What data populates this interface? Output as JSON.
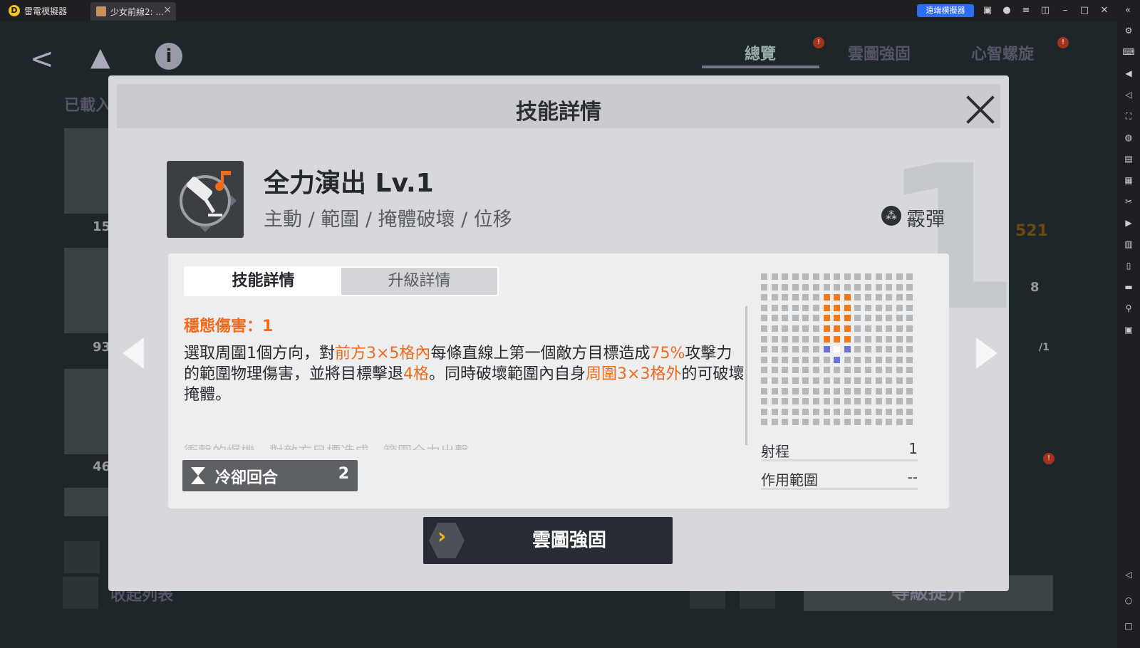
{
  "window": {
    "app_name": "雷電模擬器",
    "tab_label": "少女前線2: ...",
    "tab_close": "×",
    "sync_button": "遠端模擬器",
    "icons": [
      "gift-icon",
      "account-icon",
      "menu-icon",
      "restore-icon",
      "minimize-icon",
      "maximize-icon",
      "close-icon",
      "collapse-icon"
    ]
  },
  "sidebar": {
    "icons": [
      "settings-icon",
      "keyboard-icon",
      "volume-up-icon",
      "volume-down-icon",
      "screenshot-icon",
      "lock-icon",
      "apk-icon",
      "robot-icon",
      "scissors-icon",
      "record-icon",
      "operation-icon",
      "multi-instance-icon",
      "folder-icon",
      "location-icon",
      "shake-icon",
      "back-icon",
      "home-icon",
      "recent-icon"
    ]
  },
  "background": {
    "top_tabs": [
      "總覽",
      "雲圖強固",
      "心智螺旋"
    ],
    "loaded_label": "已載入",
    "card_numbers": [
      "15",
      "93",
      "46"
    ],
    "right_number": "521",
    "shield_value": "8",
    "fraction": "/1",
    "collapse_label": "收起列表",
    "level_up_button": "等級提升"
  },
  "modal": {
    "title": "技能詳情",
    "big_number": "1",
    "skill_name": "全力演出 Lv.1",
    "skill_tags": "主動 / 範圍 / 掩體破壞 / 位移",
    "ammo_type": "霰彈",
    "tabs": {
      "active": "技能詳情",
      "inactive": "升級詳情"
    },
    "stable_damage": "穩態傷害：1",
    "description": {
      "p1": "選取周圍1個方向，對",
      "h1": "前方3×5格內",
      "p2": "每條直線上第一個敵方目標造成",
      "h2": "75%",
      "p3": "攻擊力的範圍物理傷害，並將目標擊退",
      "h3": "4格",
      "p4": "。同時破壞範圍內自身",
      "h4": "周圍3×3格外",
      "p5": "的可破壞掩體。"
    },
    "faded_text": "衝撃的爆機，對敵方目標造成，範圍全力出擊",
    "cooldown": {
      "label": "冷卻回合",
      "value": "2"
    },
    "stats": [
      {
        "label": "射程",
        "value": "1"
      },
      {
        "label": "作用範圍",
        "value": "--"
      }
    ],
    "action_button": "雲圖強固",
    "colors": {
      "highlight": "#f26b1d",
      "range": "#f47a18",
      "self": "#6b73d6"
    }
  }
}
